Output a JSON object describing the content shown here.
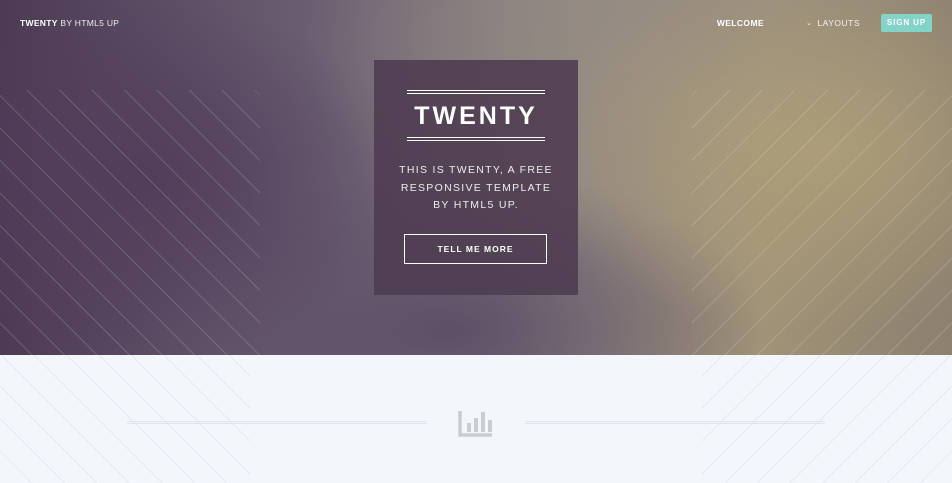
{
  "header": {
    "brand_name": "TWENTY",
    "brand_by": "BY HTML5 UP",
    "nav": {
      "welcome": "WELCOME",
      "layouts": "LAYOUTS",
      "signup": "SIGN UP"
    }
  },
  "hero": {
    "title": "TWENTY",
    "tagline": "THIS IS TWENTY, A FREE RESPONSIVE TEMPLATE BY HTML5 UP.",
    "cta_label": "TELL ME MORE"
  },
  "icons": {
    "dropdown": "chevron-down-icon",
    "section": "bar-chart-icon"
  },
  "colors": {
    "accent": "#83d3c9",
    "card_bg": "#4d3b50",
    "lower_bg": "#f3f6fa",
    "icon_gray": "#c9cdd2"
  }
}
